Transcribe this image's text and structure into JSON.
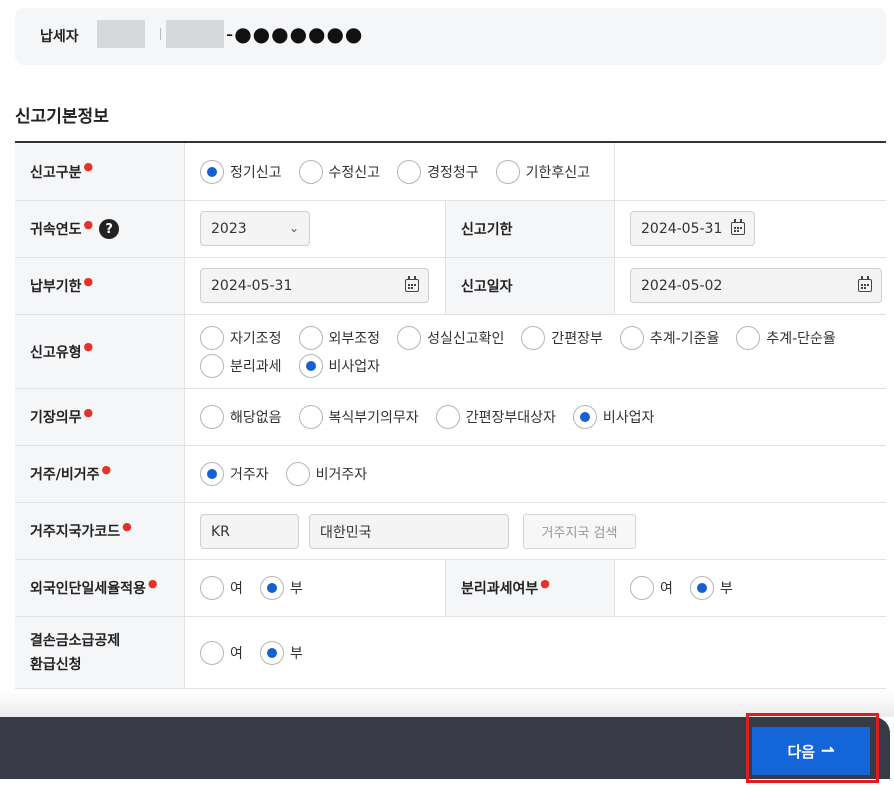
{
  "taxpayer": {
    "label": "납세자",
    "masked_suffix": "-●●●●●●●"
  },
  "section_title": "신고기본정보",
  "form": {
    "report_type": {
      "label": "신고구분",
      "options": [
        "정기신고",
        "수정신고",
        "경정청구",
        "기한후신고"
      ],
      "selected": "정기신고"
    },
    "year": {
      "label": "귀속연도",
      "help_icon": "?",
      "value": "2023"
    },
    "report_deadline": {
      "label": "신고기한",
      "value": "2024-05-31"
    },
    "payment_deadline": {
      "label": "납부기한",
      "value": "2024-05-31"
    },
    "report_date": {
      "label": "신고일자",
      "value": "2024-05-02"
    },
    "report_kind": {
      "label": "신고유형",
      "options": [
        "자기조정",
        "외부조정",
        "성실신고확인",
        "간편장부",
        "추계-기준율",
        "추계-단순율",
        "분리과세",
        "비사업자"
      ],
      "selected": "비사업자"
    },
    "bookkeeping": {
      "label": "기장의무",
      "options": [
        "해당없음",
        "복식부기의무자",
        "간편장부대상자",
        "비사업자"
      ],
      "selected": "비사업자"
    },
    "residency": {
      "label": "거주/비거주",
      "options": [
        "거주자",
        "비거주자"
      ],
      "selected": "거주자"
    },
    "country_code": {
      "label": "거주지국가코드",
      "code": "KR",
      "name": "대한민국",
      "search_button": "거주지국 검색"
    },
    "foreign_flat_rate": {
      "label": "외국인단일세율적용",
      "options": [
        "여",
        "부"
      ],
      "selected": "부"
    },
    "separate_taxation": {
      "label": "분리과세여부",
      "options": [
        "여",
        "부"
      ],
      "selected": "부"
    },
    "loss_carryback": {
      "label_line1": "결손금소급공제",
      "label_line2": "환급신청",
      "options": [
        "여",
        "부"
      ],
      "selected": "부"
    }
  },
  "footer": {
    "next_label": "다음"
  },
  "colors": {
    "accent": "#1465d8",
    "footer_bg": "#393a47",
    "required": "#e4322b",
    "highlight": "#e21b1b"
  }
}
